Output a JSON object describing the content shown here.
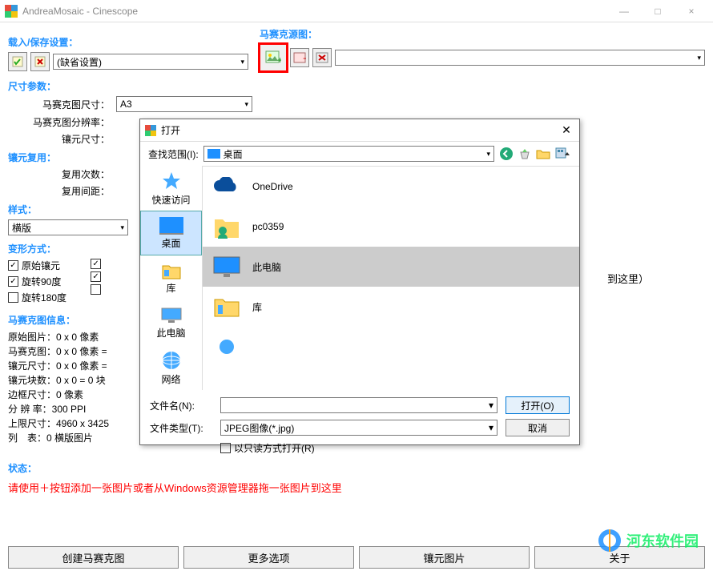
{
  "window": {
    "title": "AndreaMosaic - Cinescope",
    "min": "—",
    "max": "□",
    "close": "×"
  },
  "topsections": {
    "load_save": "载入/保存设置：",
    "preset": "(缺省设置)",
    "source": "马赛克源图："
  },
  "size_section": {
    "label": "尺寸参数：",
    "mosaic_size_label": "马赛克图尺寸：",
    "mosaic_size_value": "A3",
    "resolution_label": "马赛克图分辨率：",
    "tile_size_label": "镶元尺寸："
  },
  "reuse_section": {
    "label": "镶元复用：",
    "times_label": "复用次数：",
    "gap_label": "复用间距："
  },
  "style_section": {
    "label": "样式：",
    "value": "横版"
  },
  "transform_section": {
    "label": "变形方式：",
    "cb1": "原始镶元",
    "cb2": "旋转90度",
    "cb3": "旋转180度"
  },
  "info_section": {
    "label": "马赛克图信息：",
    "lines": [
      "原始图片：0 x 0 像素",
      "马赛克图：0 x 0 像素 =",
      "镶元尺寸：0 x 0 像素 =",
      "镶元块数：0 x 0 = 0 块",
      "边框尺寸：0 像素",
      "分 辨 率：300 PPI",
      "上限尺寸：4960 x 3425",
      "列　表：0 横版图片"
    ]
  },
  "status_section": {
    "label": "状态：",
    "text": "请使用＋按钮添加一张图片或者从Windows资源管理器拖一张图片到这里"
  },
  "drag_hint": "到这里）",
  "bottom_buttons": [
    "创建马赛克图",
    "更多选项",
    "镶元图片",
    "关于"
  ],
  "dialog": {
    "title": "打开",
    "look_in_label": "查找范围(I):",
    "look_in_value": "桌面",
    "sidebar": [
      "快速访问",
      "桌面",
      "库",
      "此电脑",
      "网络"
    ],
    "files": [
      {
        "name": "OneDrive",
        "icon": "cloud"
      },
      {
        "name": "pc0359",
        "icon": "user"
      },
      {
        "name": "此电脑",
        "icon": "pc"
      },
      {
        "name": "库",
        "icon": "lib"
      }
    ],
    "filename_label": "文件名(N):",
    "filename_value": "",
    "filetype_label": "文件类型(T):",
    "filetype_value": "JPEG图像(*.jpg)",
    "readonly": "以只读方式打开(R)",
    "open_btn": "打开(O)",
    "cancel_btn": "取消"
  },
  "watermark": "河东软件园"
}
